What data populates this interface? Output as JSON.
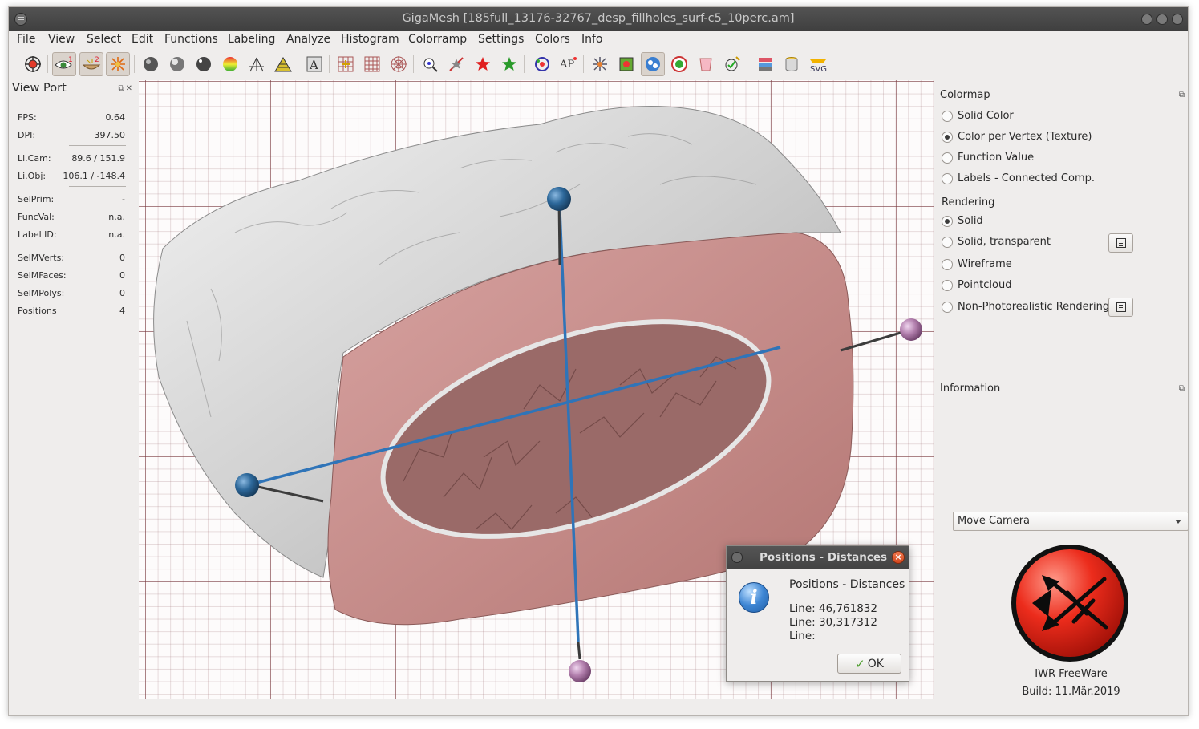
{
  "window": {
    "title": "GigaMesh [185full_13176-32767_desp_fillholes_surf-c5_10perc.am]"
  },
  "menu": [
    "File",
    "View",
    "Select",
    "Edit",
    "Functions",
    "Labeling",
    "Analyze",
    "Histogram",
    "Colorramp",
    "Settings",
    "Colors",
    "Info"
  ],
  "toolbar": {
    "icons": [
      "camera-target-icon",
      "eye-light-1-icon",
      "bowl-light-2-icon",
      "star-light-icon",
      "sphere-m-icon",
      "sphere-d-icon",
      "sphere-s-icon",
      "colormap-sphere-icon",
      "tripod-icon",
      "terrain-icon",
      "text-a-icon",
      "grid-plus-icon",
      "grid-icon",
      "polar-grid-icon",
      "eye-search-icon",
      "slash-star-icon",
      "red-star-icon",
      "green-star-icon",
      "ring-colors-icon",
      "ap-icon",
      "burst-icon",
      "puzzle-icon",
      "blobs-icon",
      "green-blob-icon",
      "pink-cup-icon",
      "check-pencil-icon",
      "stack-icon",
      "cylinder-icon",
      "svg-export-icon"
    ]
  },
  "viewport_panel": {
    "title": "View Port",
    "stats": [
      {
        "label": "FPS:",
        "value": "0.64"
      },
      {
        "label": "DPI:",
        "value": "397.50"
      },
      {
        "label": "Li.Cam:",
        "value": "89.6 / 151.9"
      },
      {
        "label": "Li.Obj:",
        "value": "106.1 / -148.4"
      },
      {
        "label": "SelPrim:",
        "value": "-"
      },
      {
        "label": "FuncVal:",
        "value": "n.a."
      },
      {
        "label": "Label ID:",
        "value": "n.a."
      },
      {
        "label": "SelMVerts:",
        "value": "0"
      },
      {
        "label": "SelMFaces:",
        "value": "0"
      },
      {
        "label": "SelMPolys:",
        "value": "0"
      },
      {
        "label": "Positions",
        "value": "4"
      }
    ]
  },
  "colormap": {
    "title": "Colormap",
    "options": [
      {
        "label": "Solid Color",
        "selected": false
      },
      {
        "label": "Color per Vertex (Texture)",
        "selected": true
      },
      {
        "label": "Function Value",
        "selected": false
      },
      {
        "label": "Labels - Connected Comp.",
        "selected": false
      }
    ]
  },
  "rendering": {
    "title": "Rendering",
    "options": [
      {
        "label": "Solid",
        "selected": true
      },
      {
        "label": "Solid, transparent",
        "selected": false
      },
      {
        "label": "Wireframe",
        "selected": false
      },
      {
        "label": "Pointcloud",
        "selected": false
      },
      {
        "label": "Non-Photorealistic Rendering",
        "selected": false
      }
    ]
  },
  "information": {
    "title": "Information"
  },
  "mouse_mode": {
    "selected": "Move Camera"
  },
  "about": {
    "name": "IWR FreeWare",
    "build": "Build: 11.Mär.2019"
  },
  "dialog": {
    "title": "Positions - Distances",
    "heading": "Positions - Distances",
    "lines": [
      "Line: 46,761832",
      "Line: 30,317312",
      "Line:"
    ],
    "ok_label": "OK"
  },
  "colors": {
    "titlebar": "#474747",
    "mesh_white": "#d8d8d8",
    "cut_surface": "#c48a88",
    "measure_line": "#2f74b8",
    "blue_marker": "#2c6799",
    "purple_marker": "#b27fad",
    "close_button": "#e05a2b"
  }
}
